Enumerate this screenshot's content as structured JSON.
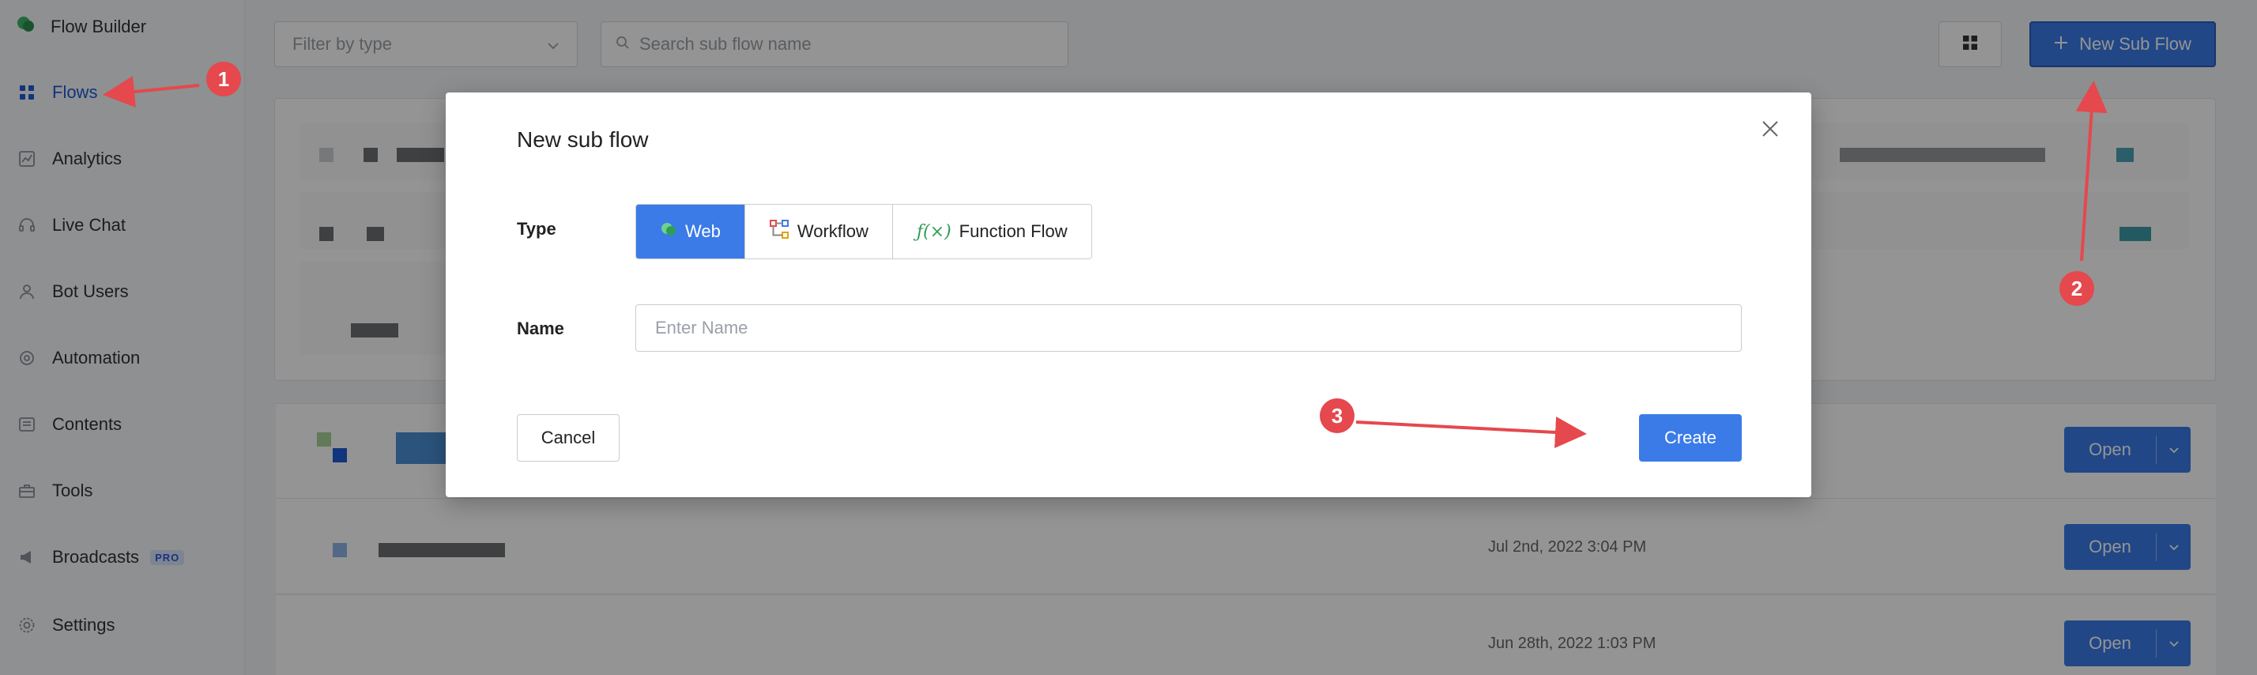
{
  "brand": {
    "title": "Flow Builder"
  },
  "sidebar": {
    "items": [
      {
        "label": "Flows",
        "icon": "grid-icon",
        "active": true
      },
      {
        "label": "Analytics",
        "icon": "chart-icon"
      },
      {
        "label": "Live Chat",
        "icon": "headset-icon"
      },
      {
        "label": "Bot Users",
        "icon": "user-icon"
      },
      {
        "label": "Automation",
        "icon": "automation-icon"
      },
      {
        "label": "Contents",
        "icon": "contents-icon"
      },
      {
        "label": "Tools",
        "icon": "toolbox-icon"
      },
      {
        "label": "Broadcasts",
        "icon": "megaphone-icon",
        "badge": "PRO"
      },
      {
        "label": "Settings",
        "icon": "gear-icon"
      }
    ]
  },
  "toolbar": {
    "filter_placeholder": "Filter by type",
    "search_placeholder": "Search sub flow name",
    "new_subflow_label": "New Sub Flow"
  },
  "rows": [
    {
      "date": "",
      "action": "Open"
    },
    {
      "date": "Jul 2nd, 2022 3:04 PM",
      "action": "Open"
    },
    {
      "date": "Jun 28th, 2022 1:03 PM",
      "action": "Open"
    }
  ],
  "modal": {
    "title": "New sub flow",
    "type_label": "Type",
    "type_options": [
      {
        "label": "Web",
        "icon": "chat-bubble-icon",
        "selected": true
      },
      {
        "label": "Workflow",
        "icon": "workflow-icon",
        "selected": false
      },
      {
        "label": "Function Flow",
        "icon": "function-icon",
        "selected": false
      }
    ],
    "name_label": "Name",
    "name_placeholder": "Enter Name",
    "cancel_label": "Cancel",
    "create_label": "Create"
  },
  "annotations": [
    "1",
    "2",
    "3"
  ],
  "colors": {
    "primary": "#3a7be8",
    "accent_red": "#e5484d",
    "active_nav": "#1f5bd8"
  }
}
